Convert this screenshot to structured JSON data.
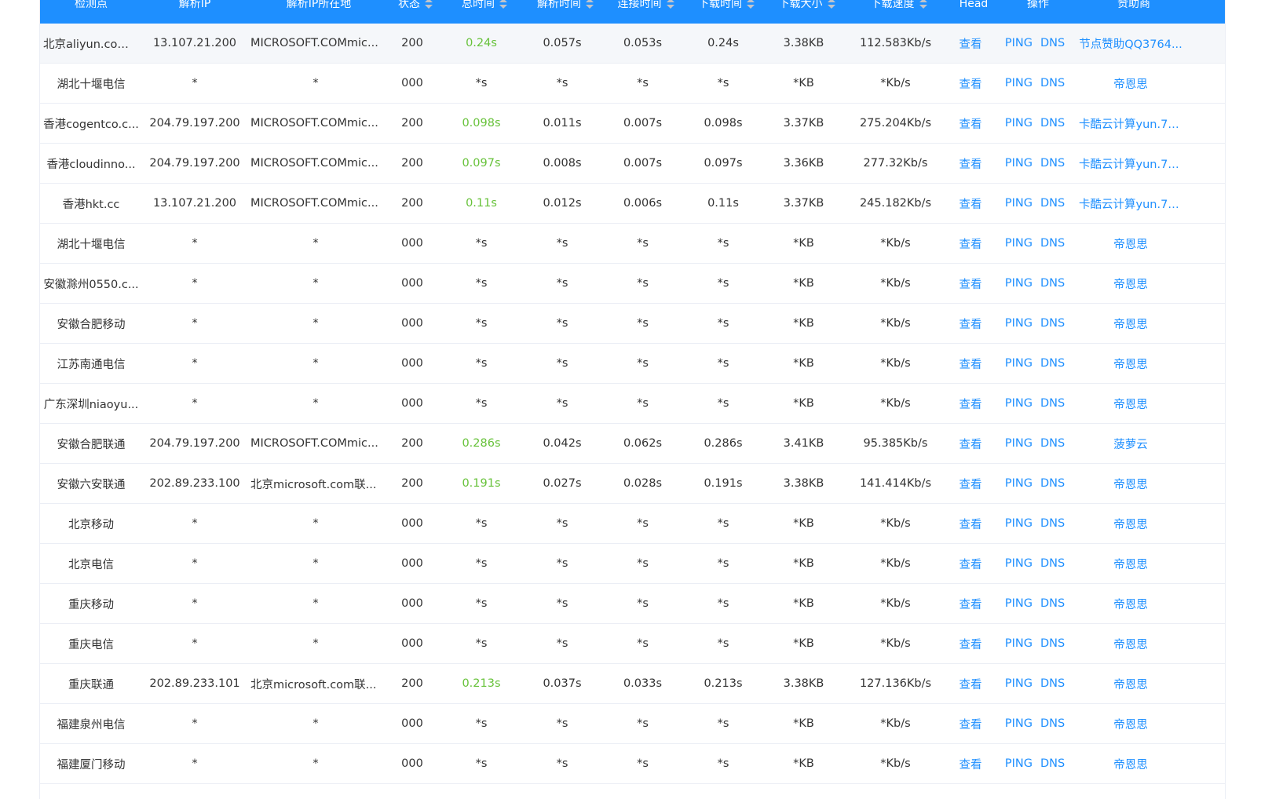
{
  "colors": {
    "header_bg": "#1e8fff",
    "link": "#1e8fff",
    "fast": "#67c23a",
    "row_highlight": "#f5f7fa"
  },
  "header": {
    "columns": [
      {
        "label": "检测点",
        "sortable": false
      },
      {
        "label": "解析IP",
        "sortable": false
      },
      {
        "label": "解析IP所在地",
        "sortable": false
      },
      {
        "label": "状态",
        "sortable": true
      },
      {
        "label": "总时间",
        "sortable": true
      },
      {
        "label": "解析时间",
        "sortable": true
      },
      {
        "label": "连接时间",
        "sortable": true
      },
      {
        "label": "下载时间",
        "sortable": true
      },
      {
        "label": "下载大小",
        "sortable": true
      },
      {
        "label": "下载速度",
        "sortable": true
      },
      {
        "label": "Head",
        "sortable": false
      },
      {
        "label": "操作",
        "sortable": false
      },
      {
        "label": "赞助商",
        "sortable": false
      }
    ]
  },
  "actions": {
    "view": "查看",
    "ping": "PING",
    "dns": "DNS"
  },
  "rows": [
    {
      "node": "北京aliyun.com...",
      "ip": "13.107.21.200",
      "loc": "MICROSOFT.COMmic...",
      "status": "200",
      "total": "0.24s",
      "resolve": "0.057s",
      "connect": "0.053s",
      "download": "0.24s",
      "size": "3.38KB",
      "speed": "112.583Kb/s",
      "sponsor": "节点赞助QQ3764...",
      "highlight": true
    },
    {
      "node": "湖北十堰电信",
      "ip": "*",
      "loc": "*",
      "status": "000",
      "total": "*s",
      "resolve": "*s",
      "connect": "*s",
      "download": "*s",
      "size": "*KB",
      "speed": "*Kb/s",
      "sponsor": "帝恩思"
    },
    {
      "node": "香港cogentco.c...",
      "ip": "204.79.197.200",
      "loc": "MICROSOFT.COMmic...",
      "status": "200",
      "total": "0.098s",
      "resolve": "0.011s",
      "connect": "0.007s",
      "download": "0.098s",
      "size": "3.37KB",
      "speed": "275.204Kb/s",
      "sponsor": "卡酷云计算yun.7k..."
    },
    {
      "node": "香港cloudinno...",
      "ip": "204.79.197.200",
      "loc": "MICROSOFT.COMmic...",
      "status": "200",
      "total": "0.097s",
      "resolve": "0.008s",
      "connect": "0.007s",
      "download": "0.097s",
      "size": "3.36KB",
      "speed": "277.32Kb/s",
      "sponsor": "卡酷云计算yun.7k..."
    },
    {
      "node": "香港hkt.cc",
      "ip": "13.107.21.200",
      "loc": "MICROSOFT.COMmic...",
      "status": "200",
      "total": "0.11s",
      "resolve": "0.012s",
      "connect": "0.006s",
      "download": "0.11s",
      "size": "3.37KB",
      "speed": "245.182Kb/s",
      "sponsor": "卡酷云计算yun.7k..."
    },
    {
      "node": "湖北十堰电信",
      "ip": "*",
      "loc": "*",
      "status": "000",
      "total": "*s",
      "resolve": "*s",
      "connect": "*s",
      "download": "*s",
      "size": "*KB",
      "speed": "*Kb/s",
      "sponsor": "帝恩思"
    },
    {
      "node": "安徽滁州0550.c...",
      "ip": "*",
      "loc": "*",
      "status": "000",
      "total": "*s",
      "resolve": "*s",
      "connect": "*s",
      "download": "*s",
      "size": "*KB",
      "speed": "*Kb/s",
      "sponsor": "帝恩思"
    },
    {
      "node": "安徽合肥移动",
      "ip": "*",
      "loc": "*",
      "status": "000",
      "total": "*s",
      "resolve": "*s",
      "connect": "*s",
      "download": "*s",
      "size": "*KB",
      "speed": "*Kb/s",
      "sponsor": "帝恩思"
    },
    {
      "node": "江苏南通电信",
      "ip": "*",
      "loc": "*",
      "status": "000",
      "total": "*s",
      "resolve": "*s",
      "connect": "*s",
      "download": "*s",
      "size": "*KB",
      "speed": "*Kb/s",
      "sponsor": "帝恩思"
    },
    {
      "node": "广东深圳niaoyu...",
      "ip": "*",
      "loc": "*",
      "status": "000",
      "total": "*s",
      "resolve": "*s",
      "connect": "*s",
      "download": "*s",
      "size": "*KB",
      "speed": "*Kb/s",
      "sponsor": "帝恩思"
    },
    {
      "node": "安徽合肥联通",
      "ip": "204.79.197.200",
      "loc": "MICROSOFT.COMmic...",
      "status": "200",
      "total": "0.286s",
      "resolve": "0.042s",
      "connect": "0.062s",
      "download": "0.286s",
      "size": "3.41KB",
      "speed": "95.385Kb/s",
      "sponsor": "菠萝云"
    },
    {
      "node": "安徽六安联通",
      "ip": "202.89.233.100",
      "loc": "北京microsoft.com联...",
      "status": "200",
      "total": "0.191s",
      "resolve": "0.027s",
      "connect": "0.028s",
      "download": "0.191s",
      "size": "3.38KB",
      "speed": "141.414Kb/s",
      "sponsor": "帝恩思"
    },
    {
      "node": "北京移动",
      "ip": "*",
      "loc": "*",
      "status": "000",
      "total": "*s",
      "resolve": "*s",
      "connect": "*s",
      "download": "*s",
      "size": "*KB",
      "speed": "*Kb/s",
      "sponsor": "帝恩思"
    },
    {
      "node": "北京电信",
      "ip": "*",
      "loc": "*",
      "status": "000",
      "total": "*s",
      "resolve": "*s",
      "connect": "*s",
      "download": "*s",
      "size": "*KB",
      "speed": "*Kb/s",
      "sponsor": "帝恩思"
    },
    {
      "node": "重庆移动",
      "ip": "*",
      "loc": "*",
      "status": "000",
      "total": "*s",
      "resolve": "*s",
      "connect": "*s",
      "download": "*s",
      "size": "*KB",
      "speed": "*Kb/s",
      "sponsor": "帝恩思"
    },
    {
      "node": "重庆电信",
      "ip": "*",
      "loc": "*",
      "status": "000",
      "total": "*s",
      "resolve": "*s",
      "connect": "*s",
      "download": "*s",
      "size": "*KB",
      "speed": "*Kb/s",
      "sponsor": "帝恩思"
    },
    {
      "node": "重庆联通",
      "ip": "202.89.233.101",
      "loc": "北京microsoft.com联...",
      "status": "200",
      "total": "0.213s",
      "resolve": "0.037s",
      "connect": "0.033s",
      "download": "0.213s",
      "size": "3.38KB",
      "speed": "127.136Kb/s",
      "sponsor": "帝恩思"
    },
    {
      "node": "福建泉州电信",
      "ip": "*",
      "loc": "*",
      "status": "000",
      "total": "*s",
      "resolve": "*s",
      "connect": "*s",
      "download": "*s",
      "size": "*KB",
      "speed": "*Kb/s",
      "sponsor": "帝恩思"
    },
    {
      "node": "福建厦门移动",
      "ip": "*",
      "loc": "*",
      "status": "000",
      "total": "*s",
      "resolve": "*s",
      "connect": "*s",
      "download": "*s",
      "size": "*KB",
      "speed": "*Kb/s",
      "sponsor": "帝恩思"
    }
  ]
}
